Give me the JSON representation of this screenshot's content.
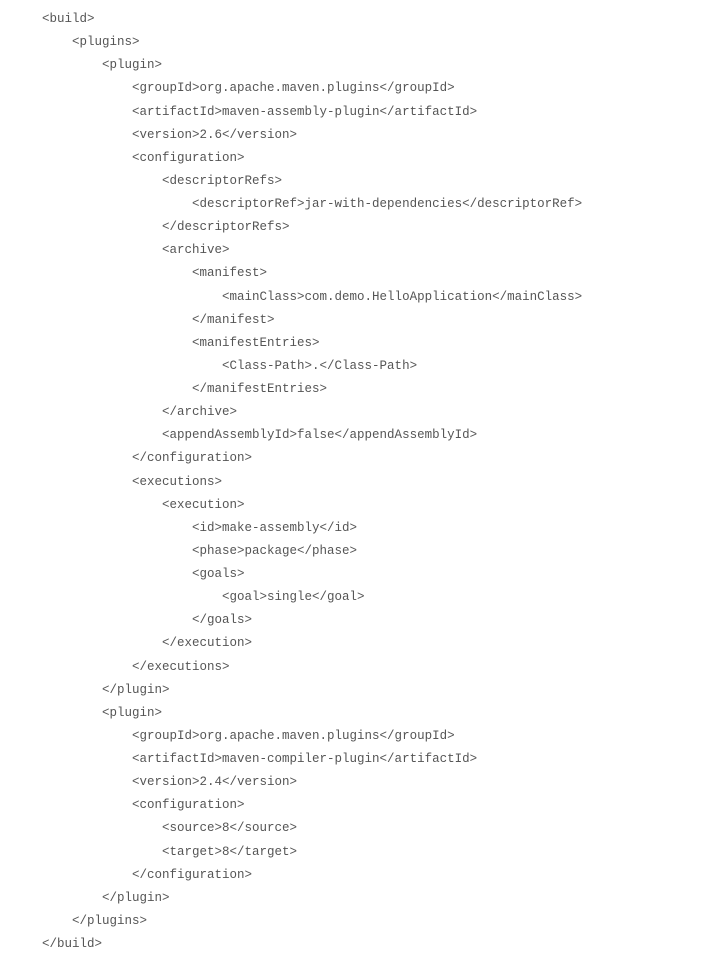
{
  "code": {
    "lines": [
      "    <build>",
      "        <plugins>",
      "            <plugin>",
      "                <groupId>org.apache.maven.plugins</groupId>",
      "                <artifactId>maven-assembly-plugin</artifactId>",
      "                <version>2.6</version>",
      "                <configuration>",
      "                    <descriptorRefs>",
      "                        <descriptorRef>jar-with-dependencies</descriptorRef>",
      "                    </descriptorRefs>",
      "                    <archive>",
      "                        <manifest>",
      "                            <mainClass>com.demo.HelloApplication</mainClass>",
      "                        </manifest>",
      "                        <manifestEntries>",
      "                            <Class-Path>.</Class-Path>",
      "                        </manifestEntries>",
      "                    </archive>",
      "                    <appendAssemblyId>false</appendAssemblyId>",
      "                </configuration>",
      "                <executions>",
      "                    <execution>",
      "                        <id>make-assembly</id>",
      "                        <phase>package</phase>",
      "                        <goals>",
      "                            <goal>single</goal>",
      "                        </goals>",
      "                    </execution>",
      "                </executions>",
      "            </plugin>",
      "            <plugin>",
      "                <groupId>org.apache.maven.plugins</groupId>",
      "                <artifactId>maven-compiler-plugin</artifactId>",
      "                <version>2.4</version>",
      "                <configuration>",
      "                    <source>8</source>",
      "                    <target>8</target>",
      "                </configuration>",
      "            </plugin>",
      "        </plugins>",
      "    </build>"
    ]
  }
}
